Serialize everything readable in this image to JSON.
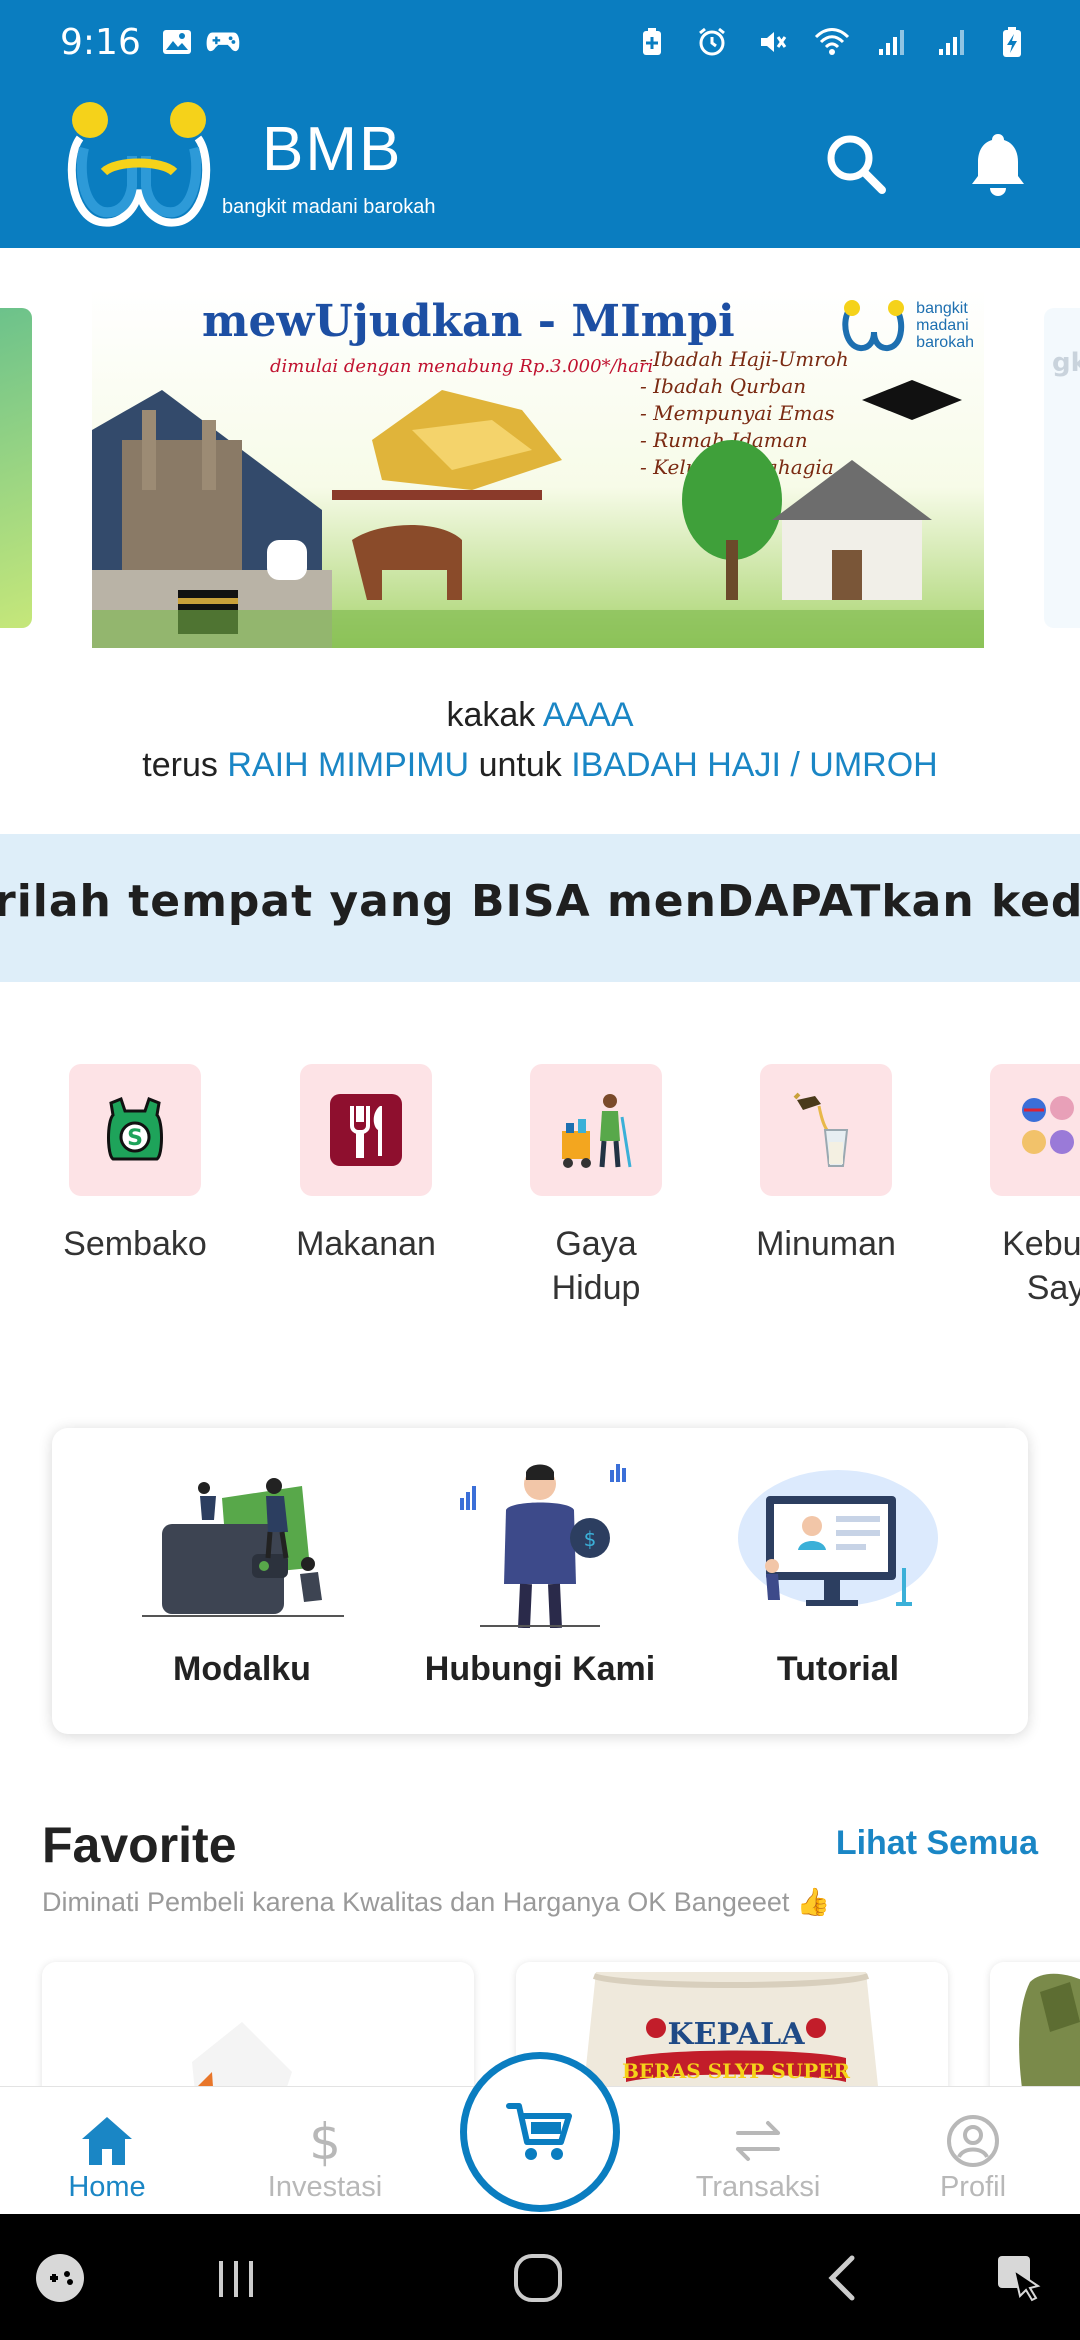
{
  "status": {
    "time": "9:16",
    "icons": [
      "image-icon",
      "gamepad-icon",
      "battery-saver-icon",
      "alarm-icon",
      "mute-icon",
      "wifi-icon",
      "signal-icon",
      "signal-icon",
      "battery-charging-icon"
    ]
  },
  "header": {
    "brand": "BMB",
    "tagline": "bangkit madani barokah",
    "colors": {
      "primary": "#0a7dc0",
      "accent": "#1a86c5",
      "logo_yellow": "#f5d21a"
    }
  },
  "banner": {
    "title": "mewUjudkan - MImpi",
    "subtitle": "dimulai dengan menabung Rp.3.000*/hari",
    "logo_text": [
      "bangkit",
      "madani",
      "barokah"
    ],
    "list": [
      "- Ibadah Haji-Umroh",
      "- Ibadah Qurban",
      "- Mempunyai Emas",
      "- Rumah Idaman",
      "- Keluarga Bahagia"
    ]
  },
  "greeting": {
    "line1_prefix": "kakak",
    "name": "AAAA",
    "line2_prefix": "terus",
    "goal": "RAIH MIMPIMU",
    "line2_middle": "untuk",
    "target": "IBADAH HAJI / UMROH"
  },
  "marquee": {
    "text": "rilah tempat yang BISA menDAPATkan kedua-"
  },
  "categories": [
    {
      "label": "Sembako",
      "icon": "grocery-bag-icon"
    },
    {
      "label": "Makanan",
      "icon": "cutlery-icon"
    },
    {
      "label": "Gaya\nHidup",
      "icon": "cleaning-cart-icon"
    },
    {
      "label": "Minuman",
      "icon": "drink-pour-icon"
    },
    {
      "label": "Kebutu\nSay",
      "icon": "personal-care-icon"
    }
  ],
  "quick_actions": [
    {
      "label": "Modalku",
      "icon": "wallet-illustration"
    },
    {
      "label": "Hubungi Kami",
      "icon": "contact-person-illustration"
    },
    {
      "label": "Tutorial",
      "icon": "video-tutorial-illustration"
    }
  ],
  "favorite": {
    "title": "Favorite",
    "see_all": "Lihat Semua",
    "subtitle": "Diminati Pembeli karena Kwalitas dan Harganya OK Bangeeet 👍",
    "products": [
      {
        "label": ""
      },
      {
        "label": "KEPALA",
        "sub": "BERAS SLYP SUPER"
      },
      {
        "label": ""
      }
    ]
  },
  "bottom_nav": {
    "items": [
      {
        "label": "Home",
        "icon": "home-icon",
        "active": true
      },
      {
        "label": "Investasi",
        "icon": "dollar-icon",
        "active": false
      },
      {
        "label": "Transaksi",
        "icon": "swap-arrows-icon",
        "active": false
      },
      {
        "label": "Profil",
        "icon": "profile-icon",
        "active": false
      }
    ],
    "center_icon": "cart-icon"
  }
}
